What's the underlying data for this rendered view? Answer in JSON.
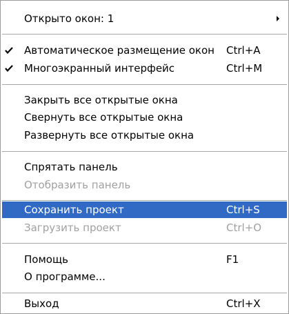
{
  "menu": {
    "items": [
      {
        "label": "Открыто окон: 1",
        "has_submenu": true
      },
      {
        "label": "Автоматическое размещение окон",
        "shortcut": "Ctrl+A",
        "checked": true
      },
      {
        "label": "Многоэкранный интерфейс",
        "shortcut": "Ctrl+M",
        "checked": true
      },
      {
        "label": "Закрыть все открытые окна"
      },
      {
        "label": "Свернуть все открытые окна"
      },
      {
        "label": "Развернуть все открытые окна"
      },
      {
        "label": "Спрятать панель"
      },
      {
        "label": "Отобразить панель",
        "disabled": true
      },
      {
        "label": "Сохранить проект",
        "shortcut": "Ctrl+S",
        "highlighted": true
      },
      {
        "label": "Загрузить проект",
        "shortcut": "Ctrl+O",
        "disabled": true
      },
      {
        "label": "Помощь",
        "shortcut": "F1"
      },
      {
        "label": "О программе..."
      },
      {
        "label": "Выход",
        "shortcut": "Ctrl+X"
      }
    ]
  },
  "colors": {
    "highlight": "#316ac5",
    "disabled_text": "#a0a0a0",
    "separator": "#a6a6a6"
  }
}
